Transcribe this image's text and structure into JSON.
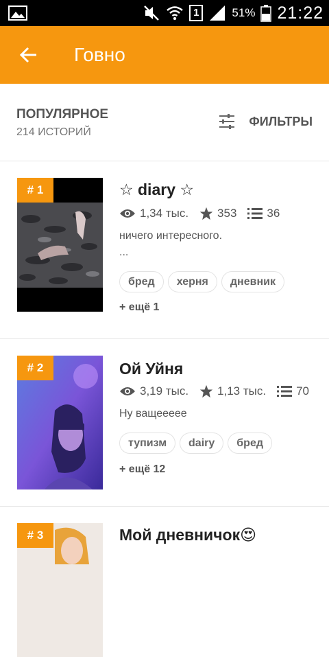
{
  "status_bar": {
    "sim_label": "1",
    "battery_percent": "51%",
    "time": "21:22"
  },
  "app_bar": {
    "title": "Говно"
  },
  "subheader": {
    "title": "ПОПУЛЯРНОЕ",
    "count": "214 ИСТОРИЙ",
    "filters_label": "ФИЛЬТРЫ"
  },
  "stories": [
    {
      "rank": "# 1",
      "title": "☆ diary ☆",
      "views": "1,34 тыс.",
      "votes": "353",
      "parts": "36",
      "description": "ничего интересного.",
      "description_more": "...",
      "tags": [
        "бред",
        "херня",
        "дневник"
      ],
      "more_tags": "+ ещё 1"
    },
    {
      "rank": "# 2",
      "title": "Ой Уйня",
      "views": "3,19 тыс.",
      "votes": "1,13 тыс.",
      "parts": "70",
      "description": "Ну ващеееее",
      "tags": [
        "тупизм",
        "dairy",
        "бред"
      ],
      "more_tags": "+ ещё 12"
    },
    {
      "rank": "# 3",
      "title": "Мой дневничок😍"
    }
  ],
  "colors": {
    "accent": "#f6970f"
  }
}
